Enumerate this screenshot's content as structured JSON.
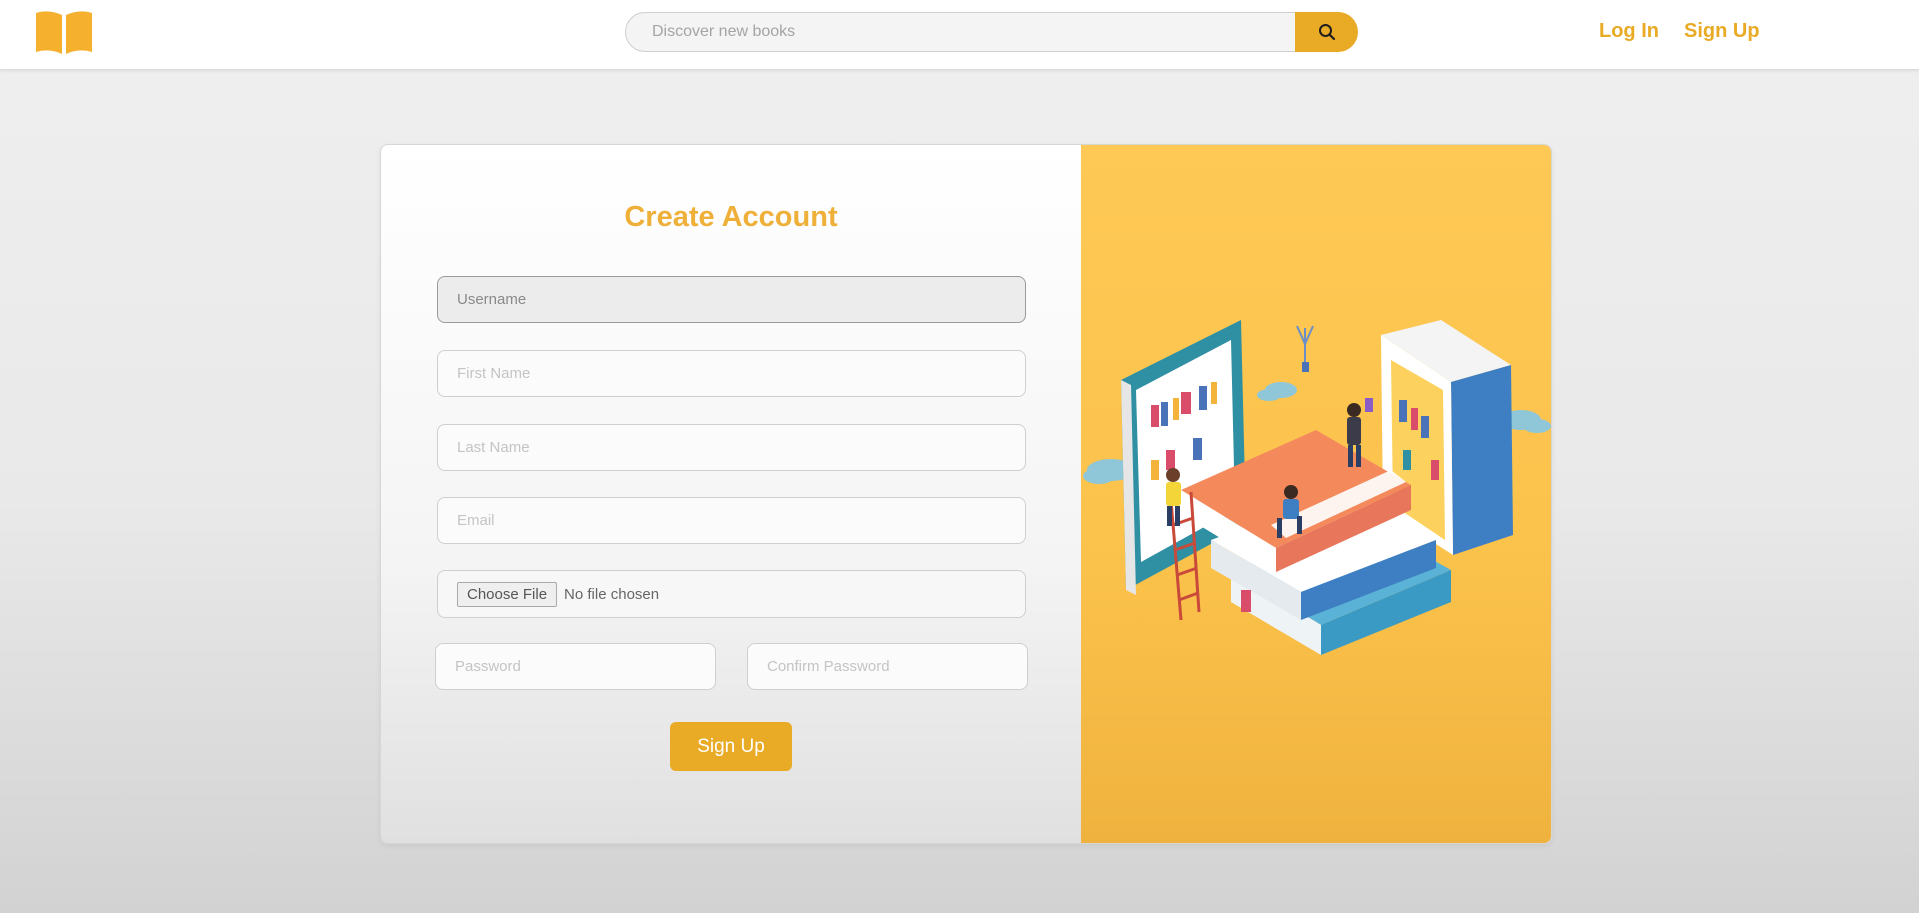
{
  "header": {
    "logo": "open-book-logo",
    "search": {
      "placeholder": "Discover new books",
      "value": "",
      "button_icon": "search-icon"
    },
    "nav": {
      "login_label": "Log In",
      "signup_label": "Sign Up"
    }
  },
  "form": {
    "title": "Create Account",
    "fields": {
      "username": {
        "placeholder": "Username",
        "value": ""
      },
      "first_name": {
        "placeholder": "First Name",
        "value": ""
      },
      "last_name": {
        "placeholder": "Last Name",
        "value": ""
      },
      "email": {
        "placeholder": "Email",
        "value": ""
      },
      "file": {
        "button_label": "Choose File",
        "status": "No file chosen"
      },
      "password": {
        "placeholder": "Password",
        "value": ""
      },
      "confirm_password": {
        "placeholder": "Confirm Password",
        "value": ""
      }
    },
    "submit_label": "Sign Up"
  },
  "illustration": {
    "name": "isometric-library-illustration"
  },
  "colors": {
    "accent": "#e9aa25",
    "title": "#efb03a",
    "art_background": "#fec955"
  }
}
